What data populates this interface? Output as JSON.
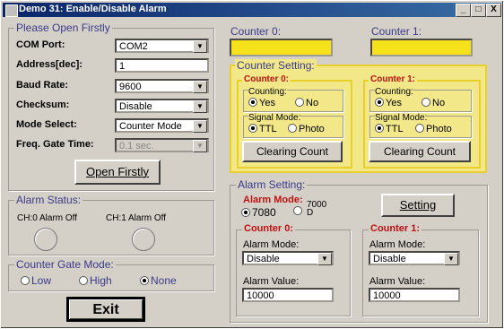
{
  "window": {
    "title": "Demo 31: Enable/Disable Alarm",
    "btn_min": "_",
    "btn_max": "□",
    "btn_close": "X"
  },
  "left": {
    "legend": "Please Open Firstly",
    "com_port": {
      "label": "COM Port:",
      "value": "COM2"
    },
    "address": {
      "label": "Address[dec]:",
      "value": "1"
    },
    "baud": {
      "label": "Baud Rate:",
      "value": "9600"
    },
    "checksum": {
      "label": "Checksum:",
      "value": "Disable"
    },
    "mode": {
      "label": "Mode Select:",
      "value": "Counter Mode"
    },
    "gate": {
      "label": "Freq. Gate Time:",
      "value": "0.1 sec."
    },
    "open_button": "Open Firstly"
  },
  "alarm_status": {
    "legend": "Alarm Status:",
    "ch0": "CH:0 Alarm Off",
    "ch1": "CH:1 Alarm Off"
  },
  "gate_mode": {
    "legend": "Counter Gate Mode:",
    "options": [
      "Low",
      "High",
      "None"
    ],
    "selected": "None"
  },
  "exit_button": "Exit",
  "counters": {
    "c0_label": "Counter 0:",
    "c1_label": "Counter 1:"
  },
  "counter_setting": {
    "legend": "Counter Setting:",
    "c0": {
      "legend": "Counter 0:",
      "counting_label": "Counting:",
      "yes": "Yes",
      "no": "No",
      "signal_label": "Signal Mode:",
      "ttl": "TTL",
      "photo": "Photo",
      "clear": "Clearing Count"
    },
    "c1": {
      "legend": "Counter 1:",
      "counting_label": "Counting:",
      "yes": "Yes",
      "no": "No",
      "signal_label": "Signal Mode:",
      "ttl": "TTL",
      "photo": "Photo",
      "clear": "Clearing Count"
    }
  },
  "alarm_setting": {
    "legend": "Alarm Setting:",
    "mode_label": "Alarm Mode:",
    "opt_7080": "7080",
    "opt_7000_a": "7000",
    "opt_7000_b": "D",
    "setting_button": "Setting",
    "c0": {
      "legend": "Counter 0:",
      "mode_label": "Alarm Mode:",
      "mode_value": "Disable",
      "value_label": "Alarm Value:",
      "value": "10000"
    },
    "c1": {
      "legend": "Counter 1:",
      "mode_label": "Alarm Mode:",
      "mode_value": "Disable",
      "value_label": "Alarm Value:",
      "value": "10000"
    }
  }
}
